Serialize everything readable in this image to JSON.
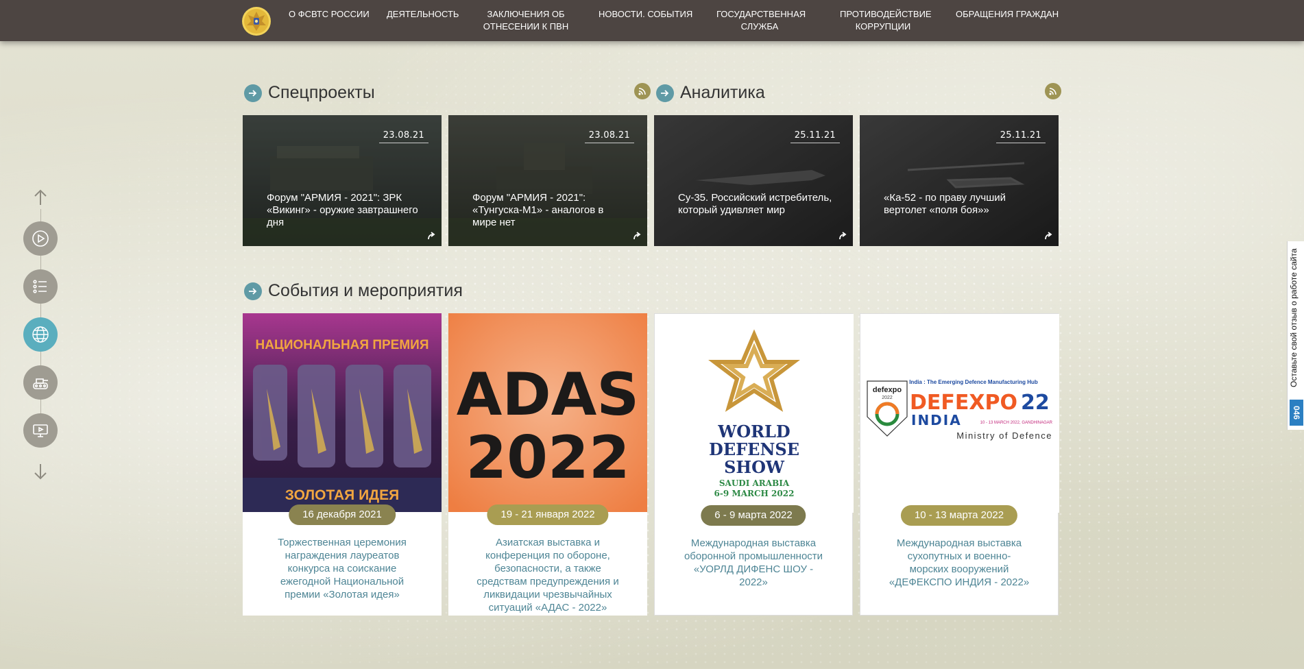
{
  "nav": {
    "items": [
      {
        "label": "О ФСВТС РОССИИ"
      },
      {
        "label": "ДЕЯТЕЛЬНОСТЬ"
      },
      {
        "label": "ЗАКЛЮЧЕНИЯ ОБ ОТНЕСЕНИИ К ПВН"
      },
      {
        "label": "НОВОСТИ. СОБЫТИЯ"
      },
      {
        "label": "ГОСУДАРСТВЕННАЯ СЛУЖБА"
      },
      {
        "label": "ПРОТИВОДЕЙСТВИЕ КОРРУПЦИИ"
      },
      {
        "label": "ОБРАЩЕНИЯ ГРАЖДАН"
      }
    ]
  },
  "sections": {
    "special": "Спецпроекты",
    "analytics": "Аналитика",
    "events": "События и мероприятия"
  },
  "news": [
    {
      "date": "23.08.21",
      "title": "Форум \"АРМИЯ - 2021\": ЗРК «Викинг» - оружие завтрашнего дня"
    },
    {
      "date": "23.08.21",
      "title": "Форум \"АРМИЯ - 2021\": «Тунгуска-М1» - аналогов в мире нет"
    },
    {
      "date": "25.11.21",
      "title": "Су-35. Российский истребитель, который удивляет мир"
    },
    {
      "date": "25.11.21",
      "title": "«Ка-52 - по праву лучший вертолет «поля боя»»"
    }
  ],
  "events": [
    {
      "date": "16 декабря 2021",
      "text": "Торжественная церемония награждения лауреатов конкурса на соискание ежегодной Национальной премии «Золотая идея»",
      "date_color": "#8a8350",
      "img": {
        "line1": "НАЦИОНАЛЬНАЯ ПРЕМИЯ",
        "line2": "ЗОЛОТАЯ ИДЕЯ"
      }
    },
    {
      "date": "19 - 21 января 2022",
      "text": "Азиатская выставка и конференция по обороне, безопасности, а также средствам предупреждения и ликвидации чрезвычайных ситуаций «АДАС - 2022»",
      "date_color": "#a99d52",
      "img": {
        "line1": "ADAS",
        "line2": "2022"
      }
    },
    {
      "date": "6 - 9 марта 2022",
      "text": "Международная выставка оборонной промышленности «УОРЛД ДИФЕНС ШОУ - 2022»",
      "date_color": "#7d7a4e",
      "img": {
        "line1": "WORLD",
        "line2": "DEFENSE",
        "line3": "SHOW",
        "line4": "SAUDI ARABIA",
        "line5": "6-9 MARCH 2022"
      }
    },
    {
      "date": "10 - 13 марта 2022",
      "text": "Международная выставка сухопутных и военно- морских вооружений «ДЕФЕКСПО ИНДИЯ - 2022»",
      "date_color": "#a99d52",
      "img": {
        "line1": "India : The Emerging Defence Manufacturing Hub",
        "line2": "DEFEXPO",
        "line3": "22",
        "line4": "INDIA",
        "line5": "10 - 13 MARCH 2022, GANDHINAGAR",
        "line6": "Ministry of Defence",
        "line7": "defexpo",
        "line8": "2022"
      }
    }
  ],
  "feedback": {
    "label": "Оставьте свой отзыв о работе сайта",
    "count": "046"
  },
  "colors": {
    "nav_bg": "#4d4542",
    "accent_teal": "#5f9aa5",
    "rss": "#9e9454",
    "event_text": "#4e8595"
  }
}
